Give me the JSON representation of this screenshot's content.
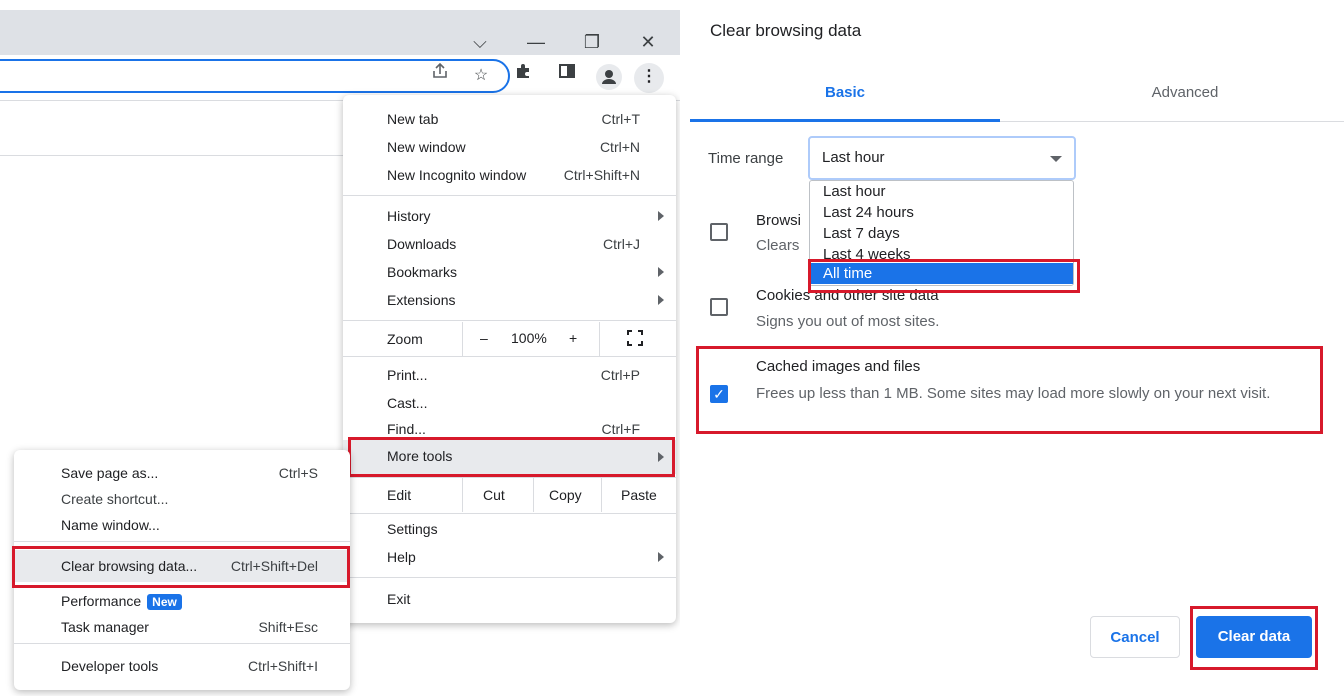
{
  "window": {
    "controls": {
      "dropdown": "⌵",
      "minimize": "—",
      "restore": "❐",
      "close": "✕"
    }
  },
  "menu": {
    "items_top": [
      {
        "label": "New tab",
        "shortcut": "Ctrl+T"
      },
      {
        "label": "New window",
        "shortcut": "Ctrl+N"
      },
      {
        "label": "New Incognito window",
        "shortcut": "Ctrl+Shift+N"
      }
    ],
    "items_mid": [
      {
        "label": "History",
        "shortcut": ""
      },
      {
        "label": "Downloads",
        "shortcut": "Ctrl+J"
      },
      {
        "label": "Bookmarks",
        "shortcut": ""
      },
      {
        "label": "Extensions",
        "shortcut": ""
      }
    ],
    "zoom": {
      "label": "Zoom",
      "minus": "–",
      "value": "100%",
      "plus": "+"
    },
    "items_print": [
      {
        "label": "Print...",
        "shortcut": "Ctrl+P"
      },
      {
        "label": "Cast...",
        "shortcut": ""
      },
      {
        "label": "Find...",
        "shortcut": "Ctrl+F"
      },
      {
        "label": "More tools",
        "shortcut": ""
      }
    ],
    "edit": {
      "label": "Edit",
      "cut": "Cut",
      "copy": "Copy",
      "paste": "Paste"
    },
    "settings": "Settings",
    "help": "Help",
    "exit": "Exit"
  },
  "submenu": {
    "items": [
      {
        "label": "Save page as...",
        "shortcut": "Ctrl+S"
      },
      {
        "label": "Create shortcut...",
        "shortcut": ""
      },
      {
        "label": "Name window...",
        "shortcut": ""
      },
      {
        "label": "Clear browsing data...",
        "shortcut": "Ctrl+Shift+Del"
      },
      {
        "label": "Performance",
        "shortcut": "",
        "badge": "New"
      },
      {
        "label": "Task manager",
        "shortcut": "Shift+Esc"
      },
      {
        "label": "Developer tools",
        "shortcut": "Ctrl+Shift+I"
      }
    ]
  },
  "dialog": {
    "title": "Clear browsing data",
    "tabs": [
      "Basic",
      "Advanced"
    ],
    "time_range_label": "Time range",
    "time_range_value": "Last hour",
    "time_range_options": [
      "Last hour",
      "Last 24 hours",
      "Last 7 days",
      "Last 4 weeks",
      "All time"
    ],
    "selected_option": "All time",
    "items": [
      {
        "title": "Browsi",
        "desc": "Clears",
        "checked": false
      },
      {
        "title": "Cookies and other site data",
        "desc": "Signs you out of most sites.",
        "checked": false
      },
      {
        "title": "Cached images and files",
        "desc": "Frees up less than 1 MB. Some sites may load more slowly on your next visit.",
        "checked": true
      }
    ],
    "cancel_label": "Cancel",
    "clear_label": "Clear data"
  },
  "colors": {
    "accent": "#1a73e8",
    "highlight_box": "#d7192b"
  }
}
